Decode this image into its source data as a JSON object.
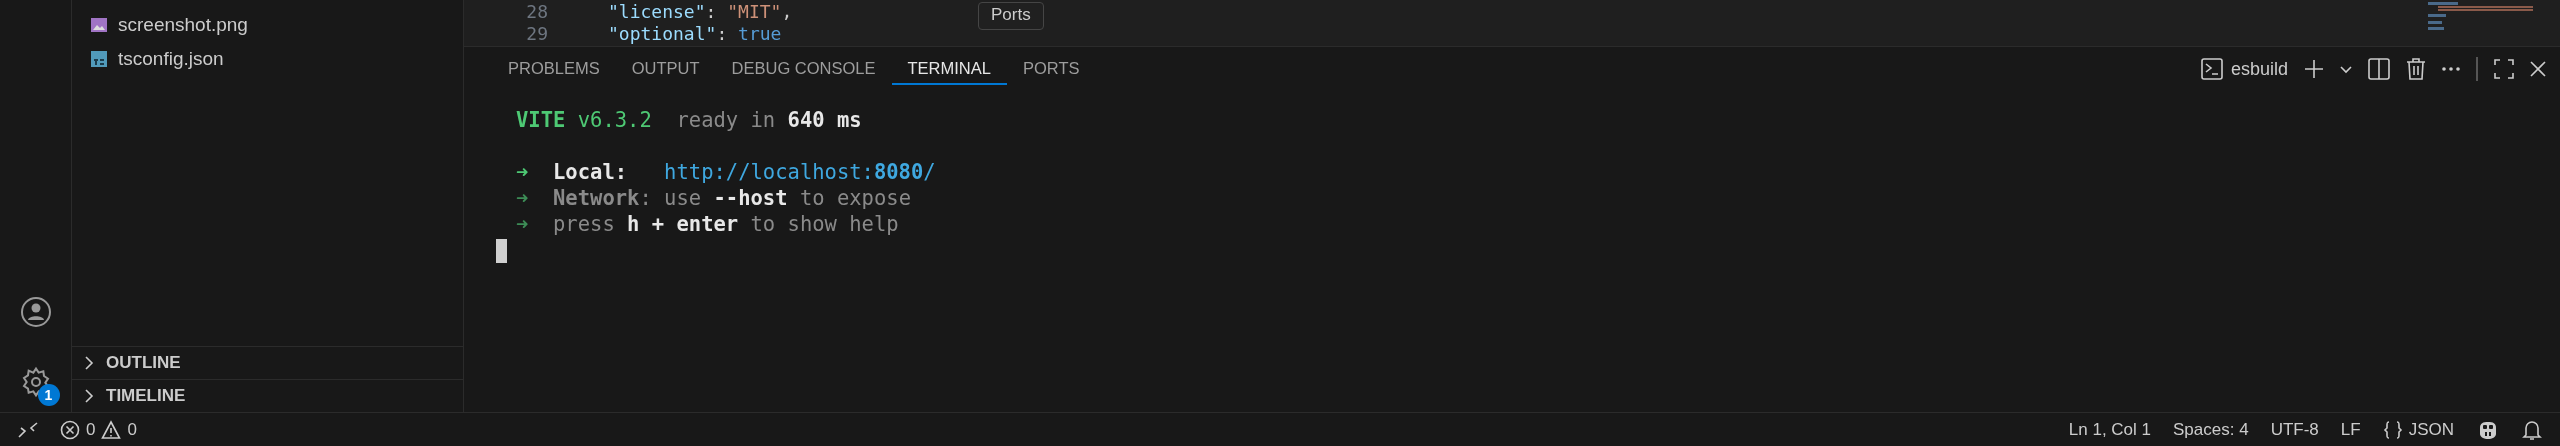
{
  "sidebar": {
    "files": [
      {
        "name": "screenshot.png",
        "kind": "image"
      },
      {
        "name": "tsconfig.json",
        "kind": "ts"
      }
    ],
    "sections": [
      {
        "label": "OUTLINE",
        "expanded": false
      },
      {
        "label": "TIMELINE",
        "expanded": false
      }
    ]
  },
  "activity_bar": {
    "settings_badge": "1"
  },
  "editor": {
    "lines": [
      {
        "number": "28",
        "segments": [
          {
            "text": "\"license\"",
            "kind": "key"
          },
          {
            "text": ": ",
            "kind": "punct"
          },
          {
            "text": "\"MIT\"",
            "kind": "string"
          },
          {
            "text": ",",
            "kind": "punct"
          }
        ]
      },
      {
        "number": "29",
        "segments": [
          {
            "text": "\"optional\"",
            "kind": "key"
          },
          {
            "text": ": ",
            "kind": "punct"
          },
          {
            "text": "true",
            "kind": "keyword"
          }
        ]
      }
    ]
  },
  "panel": {
    "tabs": [
      {
        "label": "PROBLEMS",
        "selected": false
      },
      {
        "label": "OUTPUT",
        "selected": false
      },
      {
        "label": "DEBUG CONSOLE",
        "selected": false
      },
      {
        "label": "TERMINAL",
        "selected": true
      },
      {
        "label": "PORTS",
        "selected": false
      }
    ],
    "tooltip": "Ports",
    "terminal_name": "esbuild",
    "terminal": [
      [
        [
          {
            "text": "VITE",
            "kind": "brand"
          },
          {
            "text": " v6.3.2",
            "kind": "version"
          },
          {
            "text": "  ready in ",
            "kind": "muted"
          },
          {
            "text": "640 ms",
            "kind": "strong"
          }
        ]
      ],
      [
        [
          {
            "text": "➜",
            "kind": "arrow"
          },
          {
            "text": "  Local:",
            "kind": "strong"
          },
          {
            "text": "   http://localhost:",
            "kind": "url"
          },
          {
            "text": "8080",
            "kind": "url-strong"
          },
          {
            "text": "/",
            "kind": "url"
          }
        ],
        [
          {
            "text": "➜",
            "kind": "arrow-muted"
          },
          {
            "text": "  Network",
            "kind": "muted-strong"
          },
          {
            "text": ": use ",
            "kind": "muted"
          },
          {
            "text": "--host",
            "kind": "strong"
          },
          {
            "text": " to expose",
            "kind": "muted"
          }
        ],
        [
          {
            "text": "➜",
            "kind": "arrow-muted"
          },
          {
            "text": "  press ",
            "kind": "muted"
          },
          {
            "text": "h + enter",
            "kind": "strong"
          },
          {
            "text": " to show help",
            "kind": "muted"
          }
        ]
      ]
    ]
  },
  "status_bar": {
    "errors": "0",
    "warnings": "0",
    "items": [
      "Ln 1, Col 1",
      "Spaces: 4",
      "UTF-8",
      "LF"
    ],
    "language": "JSON"
  }
}
